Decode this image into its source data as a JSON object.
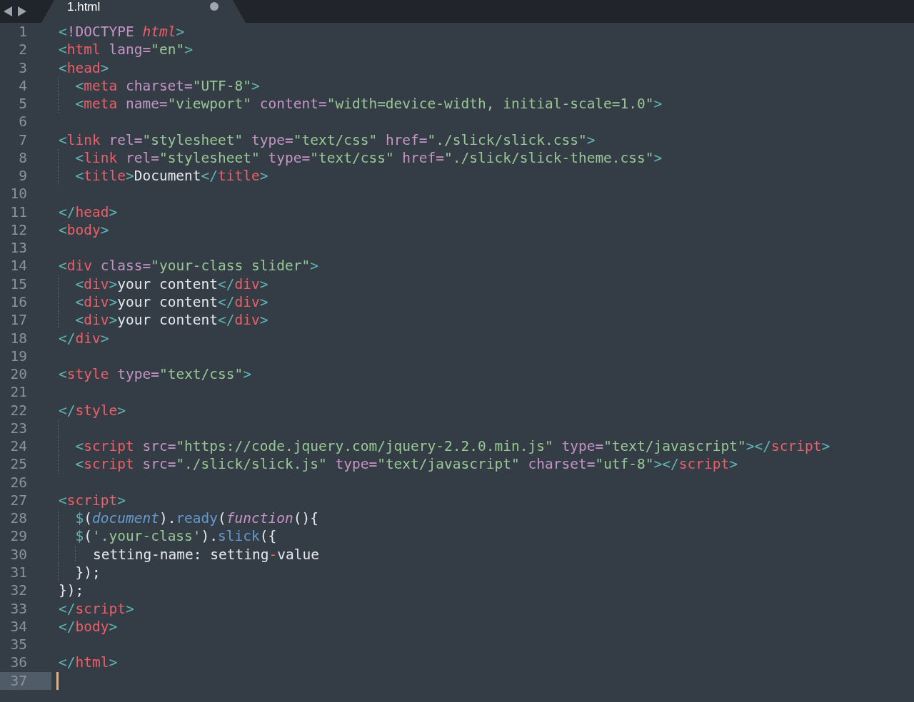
{
  "tab": {
    "title": "1.html",
    "modified": true,
    "selected": true
  },
  "lines": [
    {
      "number": "1",
      "indented": false,
      "nested": false,
      "current": false,
      "tokens": [
        {
          "kind": "p",
          "text": "<"
        },
        {
          "kind": "dt",
          "text": "!DOCTYPE "
        },
        {
          "kind": "dtv",
          "text": "html"
        },
        {
          "kind": "p",
          "text": ">"
        }
      ]
    },
    {
      "number": "2",
      "indented": false,
      "nested": false,
      "current": false,
      "tokens": [
        {
          "kind": "p",
          "text": "<"
        },
        {
          "kind": "tag",
          "text": "html "
        },
        {
          "kind": "attr",
          "text": "lang="
        },
        {
          "kind": "str",
          "text": "\"en\""
        },
        {
          "kind": "p",
          "text": ">"
        }
      ]
    },
    {
      "number": "3",
      "indented": false,
      "nested": false,
      "current": false,
      "tokens": [
        {
          "kind": "p",
          "text": "<"
        },
        {
          "kind": "tag",
          "text": "head"
        },
        {
          "kind": "p",
          "text": ">"
        }
      ]
    },
    {
      "number": "4",
      "indented": true,
      "nested": false,
      "current": false,
      "tokens": [
        {
          "kind": "p",
          "text": "<"
        },
        {
          "kind": "tag",
          "text": "meta "
        },
        {
          "kind": "attr",
          "text": "charset="
        },
        {
          "kind": "str",
          "text": "\"UTF-8\""
        },
        {
          "kind": "p",
          "text": ">"
        }
      ]
    },
    {
      "number": "5",
      "indented": true,
      "nested": false,
      "current": false,
      "tokens": [
        {
          "kind": "p",
          "text": "<"
        },
        {
          "kind": "tag",
          "text": "meta "
        },
        {
          "kind": "attr",
          "text": "name="
        },
        {
          "kind": "str",
          "text": "\"viewport\" "
        },
        {
          "kind": "attr",
          "text": "content="
        },
        {
          "kind": "str",
          "text": "\"width=device-width, initial-scale=1.0\""
        },
        {
          "kind": "p",
          "text": ">"
        }
      ]
    },
    {
      "number": "6",
      "indented": false,
      "nested": false,
      "current": false
    },
    {
      "number": "7",
      "indented": false,
      "nested": false,
      "current": false,
      "tokens": [
        {
          "kind": "p",
          "text": "<"
        },
        {
          "kind": "tag",
          "text": "link "
        },
        {
          "kind": "attr",
          "text": "rel="
        },
        {
          "kind": "str",
          "text": "\"stylesheet\" "
        },
        {
          "kind": "attr",
          "text": "type="
        },
        {
          "kind": "str",
          "text": "\"text/css\" "
        },
        {
          "kind": "attr",
          "text": "href="
        },
        {
          "kind": "str",
          "text": "\"./slick/slick.css\""
        },
        {
          "kind": "p",
          "text": ">"
        }
      ]
    },
    {
      "number": "8",
      "indented": true,
      "nested": false,
      "current": false,
      "tokens": [
        {
          "kind": "p",
          "text": "<"
        },
        {
          "kind": "tag",
          "text": "link "
        },
        {
          "kind": "attr",
          "text": "rel="
        },
        {
          "kind": "str",
          "text": "\"stylesheet\" "
        },
        {
          "kind": "attr",
          "text": "type="
        },
        {
          "kind": "str",
          "text": "\"text/css\" "
        },
        {
          "kind": "attr",
          "text": "href="
        },
        {
          "kind": "str",
          "text": "\"./slick/slick-theme.css\""
        },
        {
          "kind": "p",
          "text": ">"
        }
      ]
    },
    {
      "number": "9",
      "indented": true,
      "nested": false,
      "current": false,
      "tokens": [
        {
          "kind": "p",
          "text": "<"
        },
        {
          "kind": "tag",
          "text": "title"
        },
        {
          "kind": "p",
          "text": ">"
        },
        {
          "kind": "txt",
          "text": "Document"
        },
        {
          "kind": "p",
          "text": "</"
        },
        {
          "kind": "tag",
          "text": "title"
        },
        {
          "kind": "p",
          "text": ">"
        }
      ]
    },
    {
      "number": "10",
      "indented": false,
      "nested": false,
      "current": false
    },
    {
      "number": "11",
      "indented": false,
      "nested": false,
      "current": false,
      "tokens": [
        {
          "kind": "p",
          "text": "</"
        },
        {
          "kind": "tag",
          "text": "head"
        },
        {
          "kind": "p",
          "text": ">"
        }
      ]
    },
    {
      "number": "12",
      "indented": false,
      "nested": false,
      "current": false,
      "tokens": [
        {
          "kind": "p",
          "text": "<"
        },
        {
          "kind": "tag",
          "text": "body"
        },
        {
          "kind": "p",
          "text": ">"
        }
      ]
    },
    {
      "number": "13",
      "indented": false,
      "nested": false,
      "current": false
    },
    {
      "number": "14",
      "indented": false,
      "nested": false,
      "current": false,
      "tokens": [
        {
          "kind": "p",
          "text": "<"
        },
        {
          "kind": "tag",
          "text": "div "
        },
        {
          "kind": "attr",
          "text": "class="
        },
        {
          "kind": "str",
          "text": "\"your-class slider\""
        },
        {
          "kind": "p",
          "text": ">"
        }
      ]
    },
    {
      "number": "15",
      "indented": true,
      "nested": false,
      "current": false,
      "tokens": [
        {
          "kind": "p",
          "text": "<"
        },
        {
          "kind": "tag",
          "text": "div"
        },
        {
          "kind": "p",
          "text": ">"
        },
        {
          "kind": "txt",
          "text": "your content"
        },
        {
          "kind": "p",
          "text": "</"
        },
        {
          "kind": "tag",
          "text": "div"
        },
        {
          "kind": "p",
          "text": ">"
        }
      ]
    },
    {
      "number": "16",
      "indented": true,
      "nested": false,
      "current": false,
      "tokens": [
        {
          "kind": "p",
          "text": "<"
        },
        {
          "kind": "tag",
          "text": "div"
        },
        {
          "kind": "p",
          "text": ">"
        },
        {
          "kind": "txt",
          "text": "your content"
        },
        {
          "kind": "p",
          "text": "</"
        },
        {
          "kind": "tag",
          "text": "div"
        },
        {
          "kind": "p",
          "text": ">"
        }
      ]
    },
    {
      "number": "17",
      "indented": true,
      "nested": false,
      "current": false,
      "tokens": [
        {
          "kind": "p",
          "text": "<"
        },
        {
          "kind": "tag",
          "text": "div"
        },
        {
          "kind": "p",
          "text": ">"
        },
        {
          "kind": "txt",
          "text": "your content"
        },
        {
          "kind": "p",
          "text": "</"
        },
        {
          "kind": "tag",
          "text": "div"
        },
        {
          "kind": "p",
          "text": ">"
        }
      ]
    },
    {
      "number": "18",
      "indented": false,
      "nested": false,
      "current": false,
      "tokens": [
        {
          "kind": "p",
          "text": "</"
        },
        {
          "kind": "tag",
          "text": "div"
        },
        {
          "kind": "p",
          "text": ">"
        }
      ]
    },
    {
      "number": "19",
      "indented": false,
      "nested": false,
      "current": false
    },
    {
      "number": "20",
      "indented": false,
      "nested": false,
      "current": false,
      "tokens": [
        {
          "kind": "p",
          "text": "<"
        },
        {
          "kind": "tag",
          "text": "style "
        },
        {
          "kind": "attr",
          "text": "type="
        },
        {
          "kind": "str",
          "text": "\"text/css\""
        },
        {
          "kind": "p",
          "text": ">"
        }
      ]
    },
    {
      "number": "21",
      "indented": false,
      "nested": false,
      "current": false
    },
    {
      "number": "22",
      "indented": false,
      "nested": false,
      "current": false,
      "tokens": [
        {
          "kind": "p",
          "text": "</"
        },
        {
          "kind": "tag",
          "text": "style"
        },
        {
          "kind": "p",
          "text": ">"
        }
      ]
    },
    {
      "number": "23",
      "indented": true,
      "nested": false,
      "current": false
    },
    {
      "number": "24",
      "indented": true,
      "nested": false,
      "current": false,
      "tokens": [
        {
          "kind": "p",
          "text": "<"
        },
        {
          "kind": "tag",
          "text": "script "
        },
        {
          "kind": "attr",
          "text": "src="
        },
        {
          "kind": "str",
          "text": "\"https://code.jquery.com/jquery-2.2.0.min.js\" "
        },
        {
          "kind": "attr",
          "text": "type="
        },
        {
          "kind": "str",
          "text": "\"text/javascript\""
        },
        {
          "kind": "p",
          "text": "></"
        },
        {
          "kind": "tag",
          "text": "script"
        },
        {
          "kind": "p",
          "text": ">"
        }
      ]
    },
    {
      "number": "25",
      "indented": true,
      "nested": false,
      "current": false,
      "tokens": [
        {
          "kind": "p",
          "text": "<"
        },
        {
          "kind": "tag",
          "text": "script "
        },
        {
          "kind": "attr",
          "text": "src="
        },
        {
          "kind": "str",
          "text": "\"./slick/slick.js\" "
        },
        {
          "kind": "attr",
          "text": "type="
        },
        {
          "kind": "str",
          "text": "\"text/javascript\" "
        },
        {
          "kind": "attr",
          "text": "charset="
        },
        {
          "kind": "str",
          "text": "\"utf-8\""
        },
        {
          "kind": "p",
          "text": "></"
        },
        {
          "kind": "tag",
          "text": "script"
        },
        {
          "kind": "p",
          "text": ">"
        }
      ]
    },
    {
      "number": "26",
      "indented": false,
      "nested": false,
      "current": false
    },
    {
      "number": "27",
      "indented": false,
      "nested": false,
      "current": false,
      "tokens": [
        {
          "kind": "p",
          "text": "<"
        },
        {
          "kind": "tag",
          "text": "script"
        },
        {
          "kind": "p",
          "text": ">"
        }
      ]
    },
    {
      "number": "28",
      "indented": true,
      "nested": false,
      "current": false,
      "tokens": [
        {
          "kind": "p",
          "text": "$"
        },
        {
          "kind": "txt",
          "text": "("
        },
        {
          "kind": "obj",
          "text": "document"
        },
        {
          "kind": "txt",
          "text": ")."
        },
        {
          "kind": "fn",
          "text": "ready"
        },
        {
          "kind": "txt",
          "text": "("
        },
        {
          "kind": "kw",
          "text": "function"
        },
        {
          "kind": "txt",
          "text": "(){"
        }
      ]
    },
    {
      "number": "29",
      "indented": true,
      "nested": false,
      "current": false,
      "tokens": [
        {
          "kind": "p",
          "text": "$"
        },
        {
          "kind": "txt",
          "text": "("
        },
        {
          "kind": "str",
          "text": "'.your-class'"
        },
        {
          "kind": "txt",
          "text": ")."
        },
        {
          "kind": "fn",
          "text": "slick"
        },
        {
          "kind": "txt",
          "text": "({"
        }
      ]
    },
    {
      "number": "30",
      "indented": true,
      "nested": true,
      "current": false,
      "tokens": [
        {
          "kind": "txt",
          "text": "setting-name: setting"
        },
        {
          "kind": "op",
          "text": "-"
        },
        {
          "kind": "txt",
          "text": "value"
        }
      ]
    },
    {
      "number": "31",
      "indented": true,
      "nested": false,
      "current": false,
      "tokens": [
        {
          "kind": "txt",
          "text": "});"
        }
      ]
    },
    {
      "number": "32",
      "indented": false,
      "nested": false,
      "current": false,
      "tokens": [
        {
          "kind": "txt",
          "text": "});"
        }
      ]
    },
    {
      "number": "33",
      "indented": false,
      "nested": false,
      "current": false,
      "tokens": [
        {
          "kind": "p",
          "text": "</"
        },
        {
          "kind": "tag",
          "text": "script"
        },
        {
          "kind": "p",
          "text": ">"
        }
      ]
    },
    {
      "number": "34",
      "indented": false,
      "nested": false,
      "current": false,
      "tokens": [
        {
          "kind": "p",
          "text": "</"
        },
        {
          "kind": "tag",
          "text": "body"
        },
        {
          "kind": "p",
          "text": ">"
        }
      ]
    },
    {
      "number": "35",
      "indented": false,
      "nested": false,
      "current": false
    },
    {
      "number": "36",
      "indented": false,
      "nested": false,
      "current": false,
      "tokens": [
        {
          "kind": "p",
          "text": "</"
        },
        {
          "kind": "tag",
          "text": "html"
        },
        {
          "kind": "p",
          "text": ">"
        }
      ]
    },
    {
      "number": "37",
      "indented": false,
      "nested": false,
      "current": true
    }
  ]
}
